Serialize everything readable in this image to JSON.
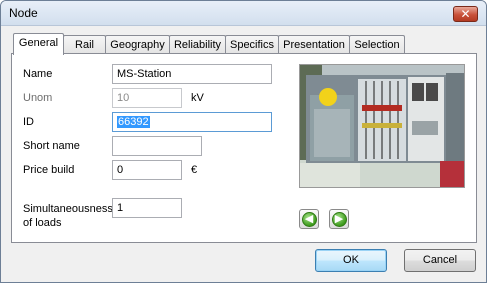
{
  "window": {
    "title": "Node",
    "close_symbol": "✕"
  },
  "tabs": [
    {
      "label": "General",
      "active": true
    },
    {
      "label": "Rail"
    },
    {
      "label": "Geography"
    },
    {
      "label": "Reliability"
    },
    {
      "label": "Specifics"
    },
    {
      "label": "Presentation"
    },
    {
      "label": "Selection"
    }
  ],
  "form": {
    "name": {
      "label": "Name",
      "value": "MS-Station"
    },
    "unom": {
      "label": "Unom",
      "value": "10",
      "unit": "kV"
    },
    "id": {
      "label": "ID",
      "value": "66392"
    },
    "short_name": {
      "label": "Short name",
      "value": ""
    },
    "price_build": {
      "label": "Price build",
      "value": "0",
      "unit": "€"
    },
    "simultaneousness": {
      "label_line1": "Simultaneousness",
      "label_line2": "of loads",
      "value": "1"
    }
  },
  "photo_nav": {
    "prev_icon": "arrow-left-icon",
    "next_icon": "arrow-right-icon"
  },
  "buttons": {
    "ok": "OK",
    "cancel": "Cancel"
  }
}
